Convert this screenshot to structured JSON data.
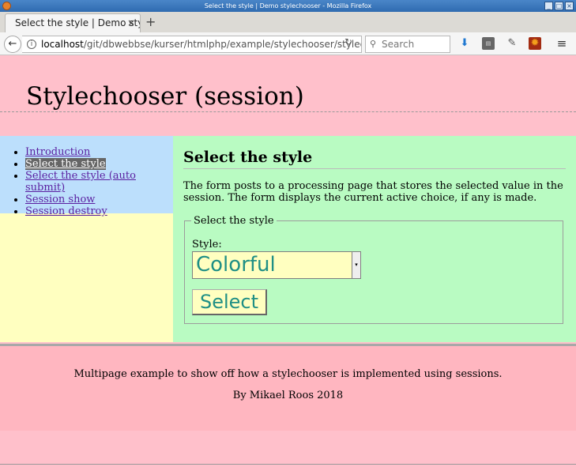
{
  "window": {
    "title": "Select the style | Demo stylechooser - Mozilla Firefox"
  },
  "browser": {
    "tab_title": "Select the style | Demo sty",
    "tab_close": "×",
    "new_tab": "+",
    "url_host": "localhost",
    "url_path": "/git/dbwebbse/kurser/htmlphp/example/stylechooser/stylechc",
    "search_placeholder": "Search",
    "icons": [
      "back-arrow",
      "info",
      "reload",
      "search",
      "download",
      "extension",
      "eyedropper",
      "addon",
      "hamburger-menu"
    ]
  },
  "header": {
    "title": "Stylechooser (session)"
  },
  "sidebar": {
    "items": [
      {
        "label": "Introduction",
        "active": false
      },
      {
        "label": "Select the style",
        "active": true
      },
      {
        "label": "Select the style (auto submit)",
        "active": false
      },
      {
        "label": "Session show",
        "active": false
      },
      {
        "label": "Session destroy",
        "active": false
      }
    ]
  },
  "main": {
    "heading": "Select the style",
    "description": "The form posts to a processing page that stores the selected value in the session. The form displays the current active choice, if any is made.",
    "form": {
      "legend": "Select the style",
      "style_label": "Style:",
      "style_value": "Colorful",
      "submit_label": "Select"
    }
  },
  "footer": {
    "line1": "Multipage example to show off how a stylechooser is implemented using sessions.",
    "line2": "By Mikael Roos 2018"
  },
  "colors": {
    "header_bg": "#ffc0cb",
    "nav_bg": "#bcdffc",
    "sidebar_bg": "#ffffc0",
    "main_bg": "#b9fbc2",
    "footer_bg": "#ffb6c0",
    "link": "#5a1fa0",
    "control_text": "#1f8f85"
  }
}
